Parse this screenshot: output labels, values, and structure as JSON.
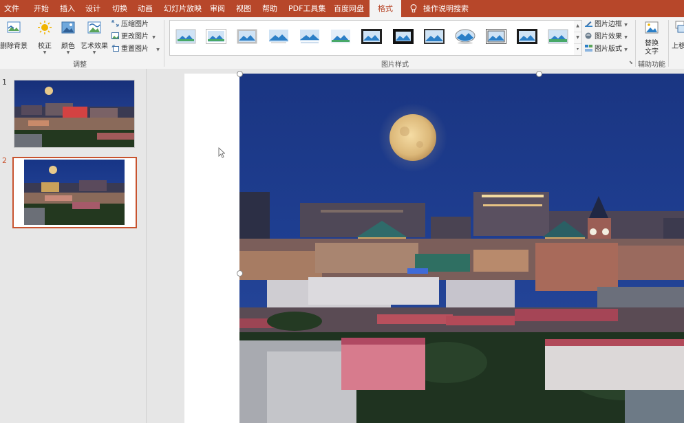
{
  "menu": {
    "tabs": [
      "文件",
      "开始",
      "插入",
      "设计",
      "切换",
      "动画",
      "幻灯片放映",
      "审阅",
      "视图",
      "帮助",
      "PDF工具集",
      "百度网盘",
      "格式"
    ],
    "active_tab": "格式",
    "tell_me": "操作说明搜索"
  },
  "ribbon": {
    "adjust": {
      "remove_background": "删除背景",
      "corrections": "校正",
      "color": "颜色",
      "artistic_effects": "艺术效果",
      "compress": "压缩图片",
      "change_picture": "更改图片",
      "reset_picture": "重置图片",
      "group_label": "调整"
    },
    "styles": {
      "group_label": "图片样式",
      "border": "图片边框",
      "effects": "图片效果",
      "layout": "图片版式"
    },
    "accessibility": {
      "alt_text": "替换\n文字",
      "group_label": "辅助功能"
    },
    "arrange": {
      "bring_forward_partial": "上移"
    }
  },
  "slides": {
    "numbers": [
      "1",
      "2"
    ],
    "selected": "2"
  },
  "colors": {
    "accent": "#b7472a",
    "ribbon_bg": "#f3f3f3",
    "selected_slide_border": "#c8532e",
    "sky": "#1c3a82"
  }
}
